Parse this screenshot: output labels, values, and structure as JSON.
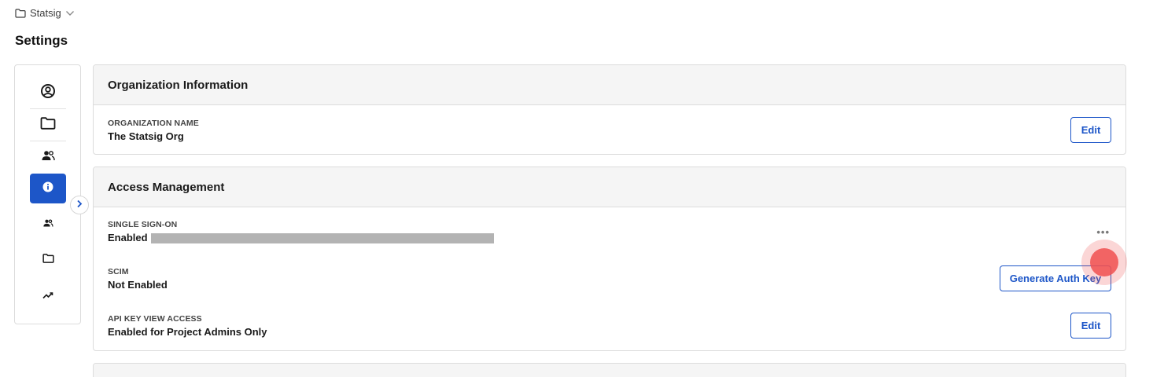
{
  "breadcrumb": {
    "label": "Statsig"
  },
  "page": {
    "title": "Settings"
  },
  "org_card": {
    "title": "Organization Information",
    "name_label": "ORGANIZATION NAME",
    "name_value": "The Statsig Org",
    "edit_label": "Edit"
  },
  "access_card": {
    "title": "Access Management",
    "sso_label": "SINGLE SIGN-ON",
    "sso_value": "Enabled",
    "more_label": "•••",
    "scim_label": "SCIM",
    "scim_value": "Not Enabled",
    "scim_button": "Generate Auth Key",
    "api_label": "API KEY VIEW ACCESS",
    "api_value": "Enabled for Project Admins Only",
    "api_edit_label": "Edit"
  },
  "sidebar": {
    "icons": [
      "user-circle-icon",
      "folder-icon",
      "users-icon",
      "info-icon",
      "users-icon",
      "folder-icon",
      "trending-icon"
    ],
    "active_index": 3
  },
  "colors": {
    "accent": "#1d56c8",
    "click_marker": "#f05050"
  }
}
